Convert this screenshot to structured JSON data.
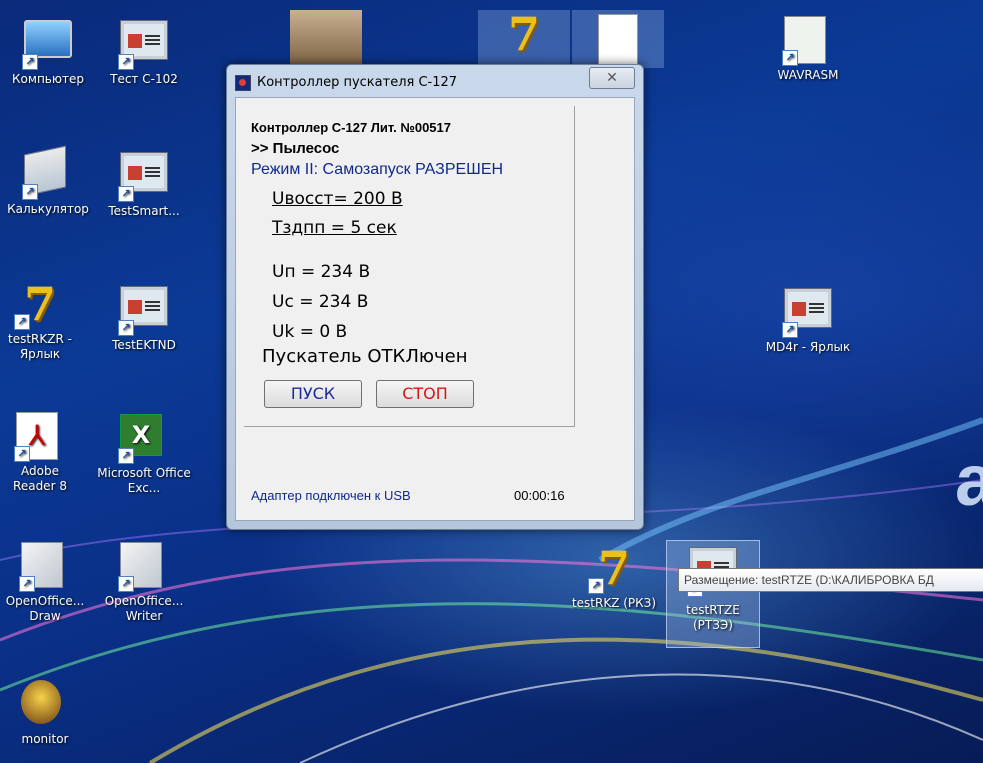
{
  "dialog": {
    "title": "Контроллер пускателя С-127",
    "close_glyph": "✕",
    "controller_line": "Контроллер С-127  Лит. №00517",
    "device_line": ">> Пылесос",
    "mode_line": "Режим II: Самозапуск РАЗРЕШЕН",
    "uvos": "Uвосст= 200 В",
    "tzdpp": "Тздпп = 5 сек",
    "up": "Uп = 234 В",
    "uc": "Uс = 234 В",
    "uk": "Uk = 0 В",
    "starter_status": "Пускатель ОТКЛючен",
    "start_label": "ПУСК",
    "stop_label": "СТОП",
    "usb_status": "Адаптер подключен к USB",
    "timer": "00:00:16"
  },
  "desktop_icons": [
    {
      "label": "Компьютер",
      "icon": "computer-icon"
    },
    {
      "label": "Тест С-102",
      "icon": "app-window-icon"
    },
    {
      "label": "Калькулятор",
      "icon": "calculator-icon"
    },
    {
      "label": "TestSmart...",
      "icon": "app-window-icon"
    },
    {
      "label": "testRKZR - Ярлык",
      "icon": "seven-globe-icon"
    },
    {
      "label": "TestEKTND",
      "icon": "app-window-icon"
    },
    {
      "label": "Adobe Reader 8",
      "icon": "pdf-icon"
    },
    {
      "label": "Microsoft Office Exc...",
      "icon": "excel-icon"
    },
    {
      "label": "OpenOffice... Draw",
      "icon": "openoffice-draw-icon"
    },
    {
      "label": "OpenOffice... Writer",
      "icon": "openoffice-writer-icon"
    },
    {
      "label": "monitor",
      "icon": "monitor-app-icon"
    },
    {
      "label": "WAVRASM",
      "icon": "document-icon"
    },
    {
      "label": "MD4r - Ярлык",
      "icon": "app-window-icon"
    },
    {
      "label": "testRKZ (РКЗ)",
      "icon": "seven-globe-icon"
    },
    {
      "label": "testRTZE (РТЗЭ)",
      "icon": "app-window-icon"
    }
  ],
  "tooltip": "Размещение: testRTZE (D:\\КАЛИБРОВКА БД",
  "shortcut_arrow": "↗"
}
